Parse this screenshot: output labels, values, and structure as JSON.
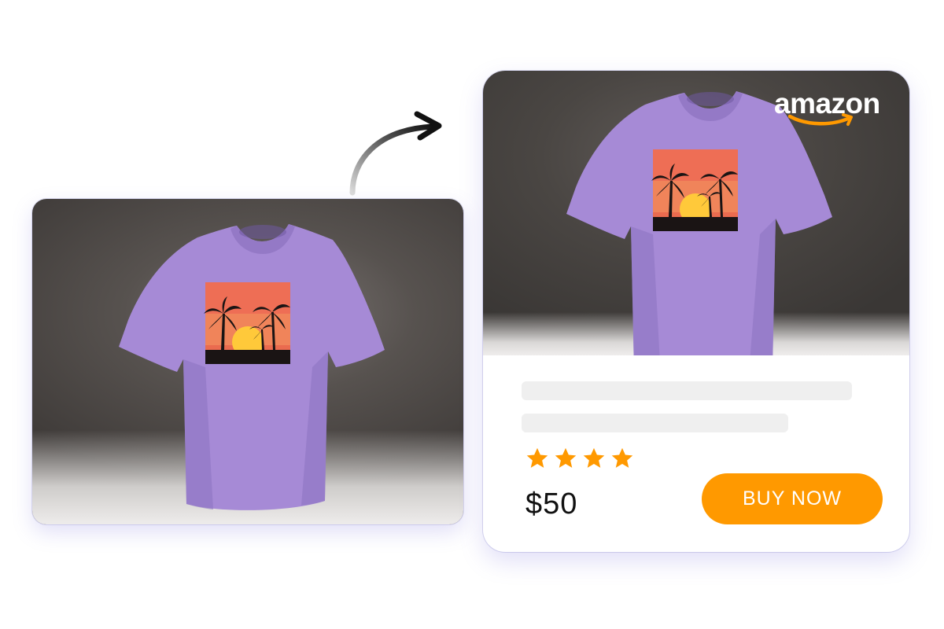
{
  "source_photo": {
    "alt": "purple t-shirt with sunset palm print"
  },
  "product_card": {
    "brand": "amazon",
    "price": "$50",
    "rating_stars": 4,
    "buy_button_label": "BUY NOW",
    "colors": {
      "accent": "#ff9900",
      "shirt": "#a68ad6",
      "skeleton": "#efefef"
    }
  }
}
